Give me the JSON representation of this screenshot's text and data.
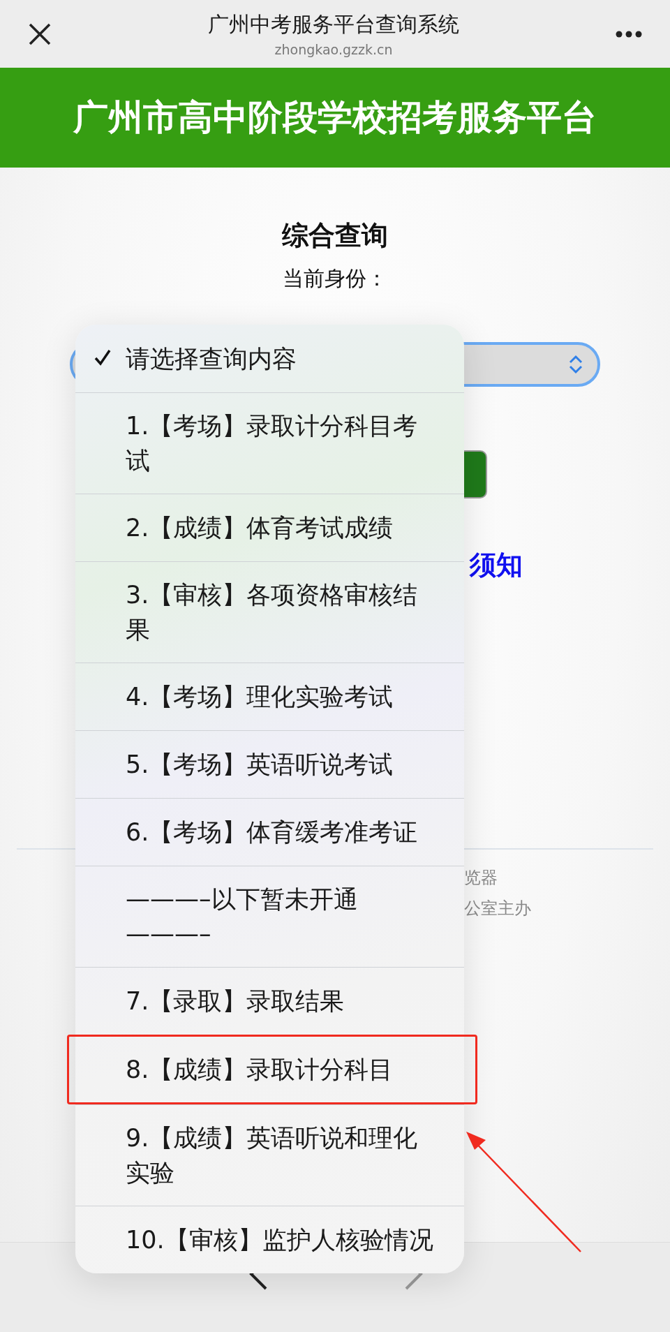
{
  "top_bar": {
    "title": "广州中考服务平台查询系统",
    "url": "zhongkao.gzzk.cn"
  },
  "banner": {
    "title": "广州市高中阶段学校招考服务平台"
  },
  "page": {
    "heading": "综合查询",
    "identity_label": "当前身份：",
    "link_fragment": "须知",
    "footer_lines": [
      "览器",
      "公室主办"
    ]
  },
  "menu": {
    "items": [
      {
        "text": "请选择查询内容",
        "selected": true,
        "highlighted": false
      },
      {
        "text": "1.【考场】录取计分科目考试",
        "selected": false,
        "highlighted": false
      },
      {
        "text": "2.【成绩】体育考试成绩",
        "selected": false,
        "highlighted": false
      },
      {
        "text": "3.【审核】各项资格审核结果",
        "selected": false,
        "highlighted": false
      },
      {
        "text": "4.【考场】理化实验考试",
        "selected": false,
        "highlighted": false
      },
      {
        "text": "5.【考场】英语听说考试",
        "selected": false,
        "highlighted": false
      },
      {
        "text": "6.【考场】体育缓考准考证",
        "selected": false,
        "highlighted": false
      },
      {
        "text": "———–以下暂未开通———–",
        "selected": false,
        "highlighted": false
      },
      {
        "text": "7.【录取】录取结果",
        "selected": false,
        "highlighted": false
      },
      {
        "text": "8.【成绩】录取计分科目",
        "selected": false,
        "highlighted": true
      },
      {
        "text": "9.【成绩】英语听说和理化实验",
        "selected": false,
        "highlighted": false
      },
      {
        "text": "10.【审核】监护人核验情况",
        "selected": false,
        "highlighted": false
      }
    ]
  }
}
